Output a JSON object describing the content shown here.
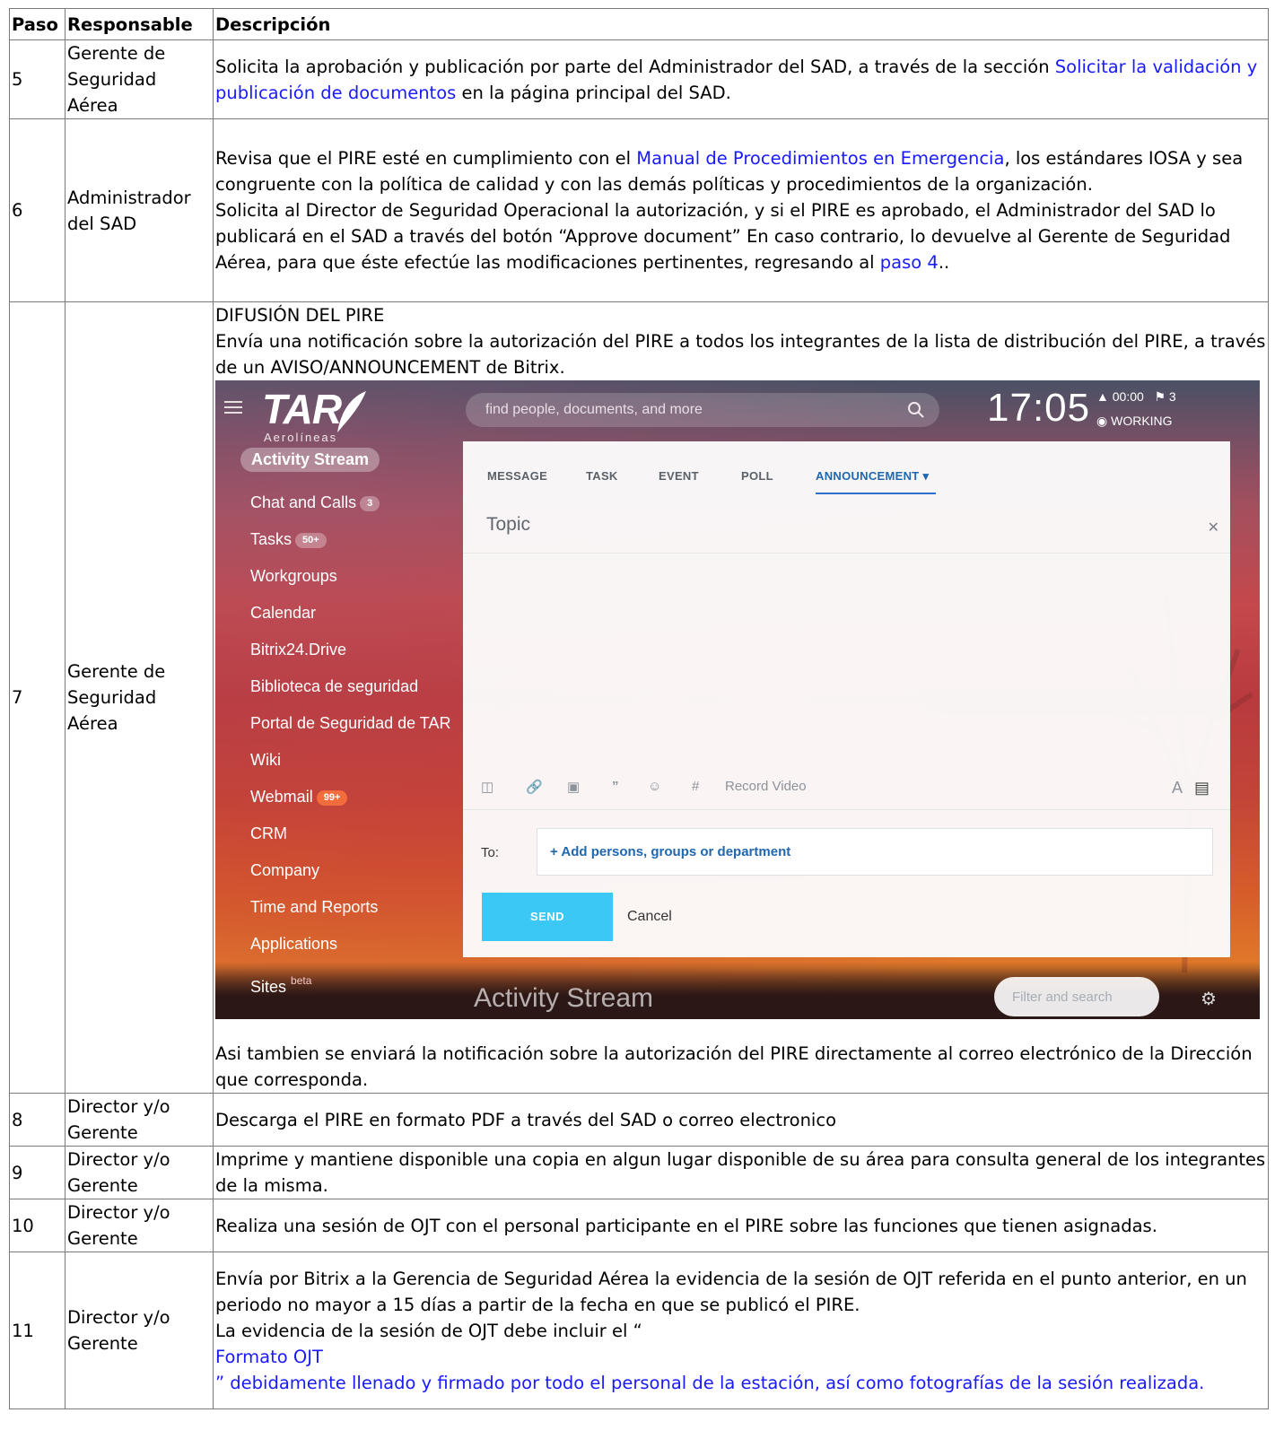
{
  "table": {
    "headers": {
      "paso": "Paso",
      "responsable": "Responsable",
      "descripcion": "Descripción"
    },
    "rows": {
      "r5": {
        "paso": "5",
        "resp": "Gerente de Seguridad Aérea",
        "d1": "Solicita la aprobación y publicación por parte del Administrador del SAD, a través de la sección ",
        "link1": "Solicitar la validación y publicación de documentos",
        "d2": " en la página principal del SAD."
      },
      "r6": {
        "paso": "6",
        "resp": "Administrador del SAD",
        "d1": "Revisa que el PIRE esté en cumplimiento con el ",
        "link1": "Manual de Procedimientos en Emergencia",
        "d2": ", los estándares IOSA y sea congruente con la política de calidad y con las demás políticas y procedimientos de la organización.",
        "d3": "Solicita al Director de Seguridad Operacional la autorización, y si el PIRE es aprobado, el Administrador del SAD lo publicará en el SAD a través del botón “Approve document” En caso contrario, lo devuelve al Gerente de Seguridad Aérea, para que éste efectúe las modificaciones pertinentes, regresando al ",
        "link2": "paso 4",
        "d4": ".."
      },
      "r7": {
        "paso": "7",
        "resp": "Gerente de Seguridad Aérea",
        "d1": "DIFUSIÓN DEL PIRE",
        "d2": "Envía una notificación sobre la autorización del PIRE a todos los integrantes de la lista de distribución del PIRE, a través de un AVISO/ANNOUNCEMENT de Bitrix.",
        "d3": "Asi tambien se enviará la notificación sobre la autorización del PIRE directamente al correo electrónico de la Dirección que corresponda."
      },
      "r8": {
        "paso": "8",
        "resp": "Director y/o Gerente",
        "d1": "Descarga el PIRE en formato PDF a través del SAD o correo electronico"
      },
      "r9": {
        "paso": "9",
        "resp": "Director y/o Gerente",
        "d1": "Imprime y mantiene disponible una copia en algun lugar disponible de su área para consulta general de los integrantes de la misma."
      },
      "r10": {
        "paso": "10",
        "resp": "Director y/o Gerente",
        "d1": "Realiza una sesión de OJT con el personal participante en el PIRE sobre las funciones que tienen asignadas."
      },
      "r11": {
        "paso": "11",
        "resp": "Director y/o Gerente",
        "d1": "Envía por Bitrix a la Gerencia de Seguridad Aérea la evidencia de la sesión de OJT referida en el punto anterior, en un periodo no mayor a 15 días a partir de la fecha en que se publicó el PIRE.",
        "d2": "La evidencia de la sesión de OJT debe incluir el “",
        "link1": "Formato OJT",
        "link2": "” debidamente llenado y firmado por todo el personal de la estación, así como fotografías de la sesión realizada."
      }
    }
  },
  "bitrix": {
    "logo_big": "TAR",
    "logo_small": "Aerolíneas",
    "search_placeholder": "find people, documents, and more",
    "clock": "17:05",
    "timer": "00:00",
    "flags": "3",
    "working": "WORKING",
    "nav": {
      "activity": "Activity Stream",
      "chat": "Chat and Calls",
      "chat_badge": "3",
      "tasks": "Tasks",
      "tasks_badge": "50+",
      "workgroups": "Workgroups",
      "calendar": "Calendar",
      "drive": "Bitrix24.Drive",
      "biblioteca": "Biblioteca de seguridad",
      "portal": "Portal de Seguridad de TAR",
      "wiki": "Wiki",
      "webmail": "Webmail",
      "webmail_badge": "99+",
      "crm": "CRM",
      "company": "Company",
      "time": "Time and Reports",
      "apps": "Applications",
      "sites": "Sites",
      "sites_sup": "beta"
    },
    "tabs": {
      "message": "MESSAGE",
      "task": "TASK",
      "event": "EVENT",
      "poll": "POLL",
      "announcement": "ANNOUNCEMENT"
    },
    "topic_placeholder": "Topic",
    "record_video": "Record Video",
    "to_label": "To:",
    "add_persons": "+ Add persons, groups or department",
    "send": "SEND",
    "cancel": "Cancel",
    "stream_title": "Activity Stream",
    "filter_placeholder": "Filter and search",
    "colors": {
      "accent_blue": "#2067b0",
      "send_button": "#3bc8f5",
      "badge_orange": "#f26d3b"
    },
    "icons": [
      "menu-icon",
      "search-icon",
      "bell-icon",
      "flag-icon",
      "working-icon",
      "close-icon",
      "file-icon",
      "link-icon",
      "video-icon",
      "quote-icon",
      "person-icon",
      "hashtag-icon",
      "font-icon",
      "editor-icon",
      "gear-icon"
    ]
  }
}
